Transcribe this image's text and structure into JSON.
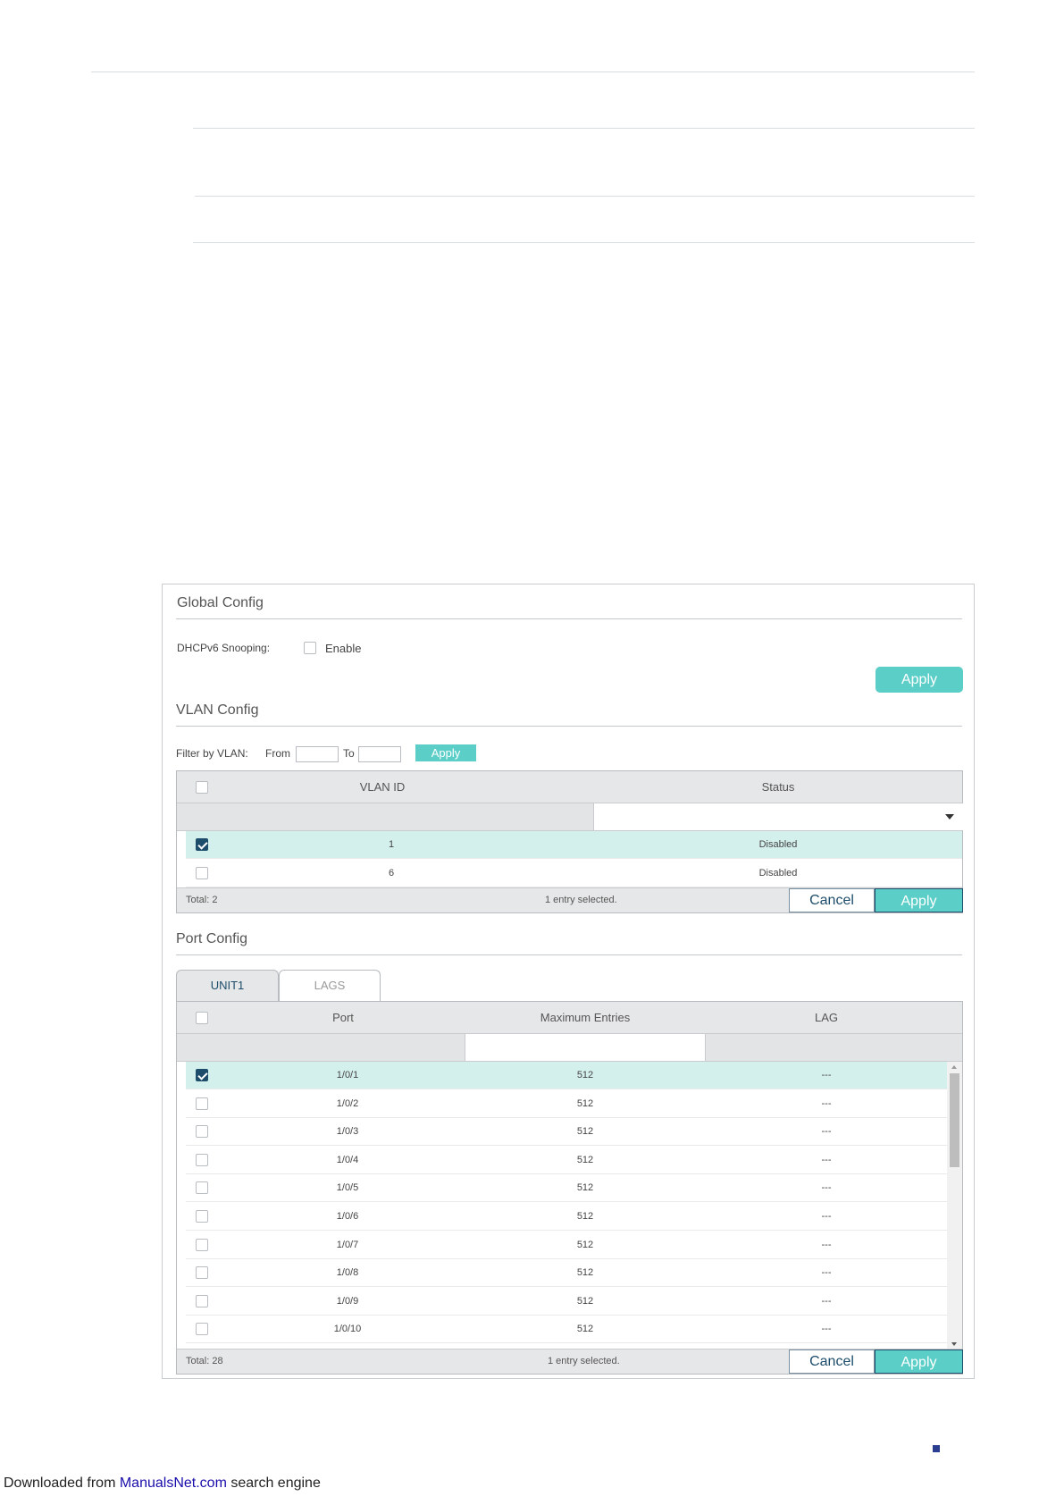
{
  "global_config": {
    "title": "Global Config",
    "dhcpv6_label": "DHCPv6 Snooping:",
    "enable_label": "Enable",
    "enable_checked": false,
    "apply_label": "Apply"
  },
  "vlan_config": {
    "title": "VLAN Config",
    "filter_label": "Filter by VLAN:",
    "from_label": "From",
    "from_value": "",
    "to_label": "To",
    "to_value": "",
    "filter_apply_label": "Apply",
    "columns": [
      "VLAN ID",
      "Status"
    ],
    "status_select_value": "",
    "rows": [
      {
        "vlan_id": "1",
        "status": "Disabled",
        "selected": true
      },
      {
        "vlan_id": "6",
        "status": "Disabled",
        "selected": false
      }
    ],
    "total": "Total: 2",
    "selection_text": "1 entry selected.",
    "cancel_label": "Cancel",
    "apply_label": "Apply"
  },
  "port_config": {
    "title": "Port Config",
    "tabs": [
      {
        "label": "UNIT1",
        "active": true
      },
      {
        "label": "LAGS",
        "active": false
      }
    ],
    "columns": [
      "Port",
      "Maximum Entries",
      "LAG"
    ],
    "max_entries_input_value": "",
    "rows": [
      {
        "port": "1/0/1",
        "max_entries": "512",
        "lag": "---",
        "selected": true
      },
      {
        "port": "1/0/2",
        "max_entries": "512",
        "lag": "---",
        "selected": false
      },
      {
        "port": "1/0/3",
        "max_entries": "512",
        "lag": "---",
        "selected": false
      },
      {
        "port": "1/0/4",
        "max_entries": "512",
        "lag": "---",
        "selected": false
      },
      {
        "port": "1/0/5",
        "max_entries": "512",
        "lag": "---",
        "selected": false
      },
      {
        "port": "1/0/6",
        "max_entries": "512",
        "lag": "---",
        "selected": false
      },
      {
        "port": "1/0/7",
        "max_entries": "512",
        "lag": "---",
        "selected": false
      },
      {
        "port": "1/0/8",
        "max_entries": "512",
        "lag": "---",
        "selected": false
      },
      {
        "port": "1/0/9",
        "max_entries": "512",
        "lag": "---",
        "selected": false
      },
      {
        "port": "1/0/10",
        "max_entries": "512",
        "lag": "---",
        "selected": false
      }
    ],
    "total": "Total: 28",
    "selection_text": "1 entry selected.",
    "cancel_label": "Cancel",
    "apply_label": "Apply"
  },
  "footer": {
    "prefix": "Downloaded from ",
    "link": "ManualsNet.com",
    "suffix": " search engine"
  },
  "colors": {
    "accent": "#5ccec8",
    "selected_row": "#d4f0ed",
    "checkbox_checked": "#1d4d6b",
    "header_bg": "#e6e7e8",
    "link": "#1a0dab",
    "page_marker": "#2b3d8f"
  }
}
